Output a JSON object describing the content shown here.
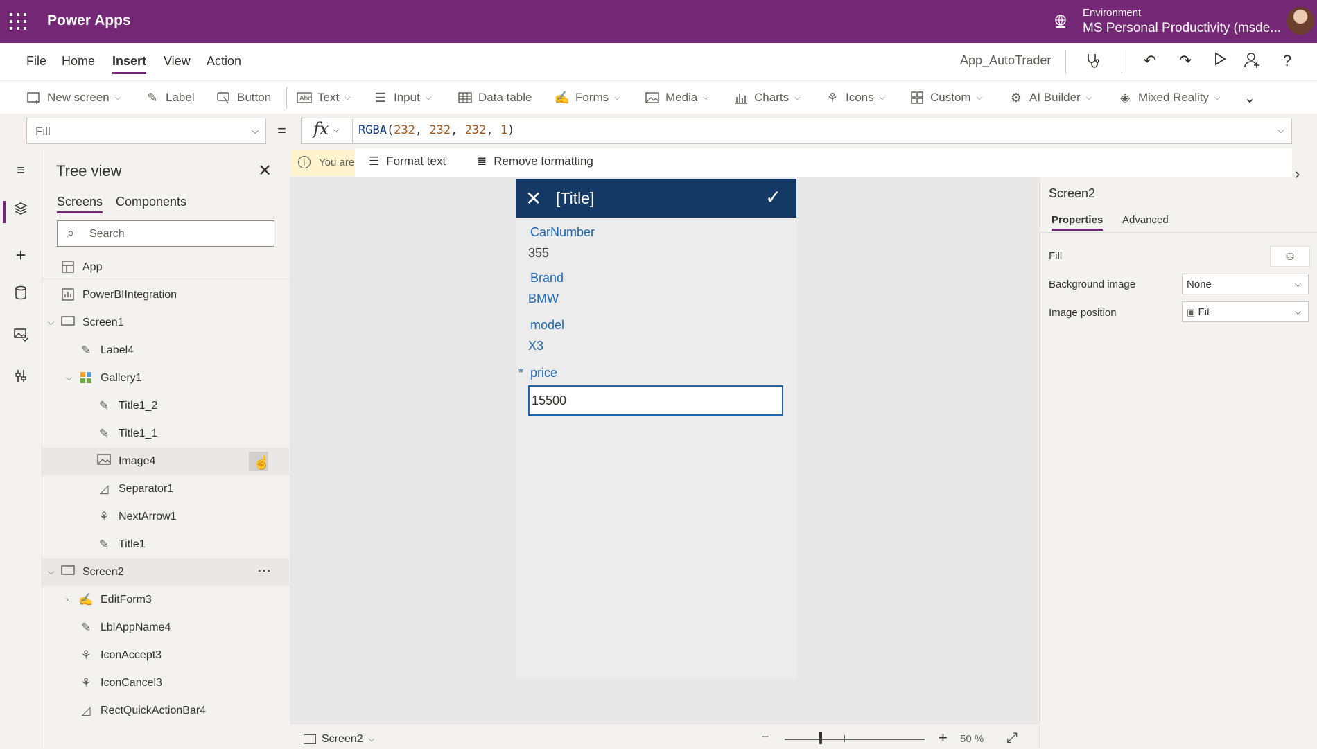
{
  "titlebar": {
    "app_name": "Power Apps",
    "environment_label": "Environment",
    "environment_value": "MS Personal Productivity (msde..."
  },
  "menu": {
    "items": [
      "File",
      "Home",
      "Insert",
      "View",
      "Action"
    ],
    "active": "Insert",
    "app_name": "App_AutoTrader"
  },
  "ribbon": {
    "new_screen": "New screen",
    "label": "Label",
    "button": "Button",
    "text": "Text",
    "input": "Input",
    "data_table": "Data table",
    "forms": "Forms",
    "media": "Media",
    "charts": "Charts",
    "icons": "Icons",
    "custom": "Custom",
    "ai_builder": "AI Builder",
    "mixed_reality": "Mixed Reality"
  },
  "formula_bar": {
    "property": "Fill",
    "equals": "=",
    "fx": "fx",
    "formula_fn": "RGBA",
    "formula_args": [
      "232",
      "232",
      "232",
      "1"
    ]
  },
  "format_menu": {
    "format_text": "Format text",
    "remove_formatting": "Remove formatting"
  },
  "warning": {
    "text": "You are"
  },
  "tree_view": {
    "title": "Tree view",
    "tabs": [
      "Screens",
      "Components"
    ],
    "search_placeholder": "Search",
    "items": [
      {
        "label": "App"
      },
      {
        "label": "PowerBIIntegration"
      },
      {
        "label": "Screen1"
      },
      {
        "label": "Label4"
      },
      {
        "label": "Gallery1"
      },
      {
        "label": "Title1_2"
      },
      {
        "label": "Title1_1"
      },
      {
        "label": "Image4"
      },
      {
        "label": "Separator1"
      },
      {
        "label": "NextArrow1"
      },
      {
        "label": "Title1"
      },
      {
        "label": "Screen2"
      },
      {
        "label": "EditForm3"
      },
      {
        "label": "LblAppName4"
      },
      {
        "label": "IconAccept3"
      },
      {
        "label": "IconCancel3"
      },
      {
        "label": "RectQuickActionBar4"
      }
    ]
  },
  "canvas": {
    "header_title": "[Title]",
    "fields": [
      {
        "label": "CarNumber",
        "value": "355"
      },
      {
        "label": "Brand",
        "value": "BMW"
      },
      {
        "label": "model",
        "value": "X3"
      }
    ],
    "price_star": "*",
    "price_label": "price",
    "price_value": "15500"
  },
  "statusbar": {
    "screen": "Screen2",
    "zoom": "50 %"
  },
  "properties_pane": {
    "name": "Screen2",
    "tabs": [
      "Properties",
      "Advanced"
    ],
    "fill_label": "Fill",
    "background_image_label": "Background image",
    "background_image_value": "None",
    "image_position_label": "Image position",
    "image_position_value": "Fit"
  },
  "colors": {
    "brand": "#742774",
    "form_header": "#143964",
    "field_label": "#1f66b2"
  }
}
